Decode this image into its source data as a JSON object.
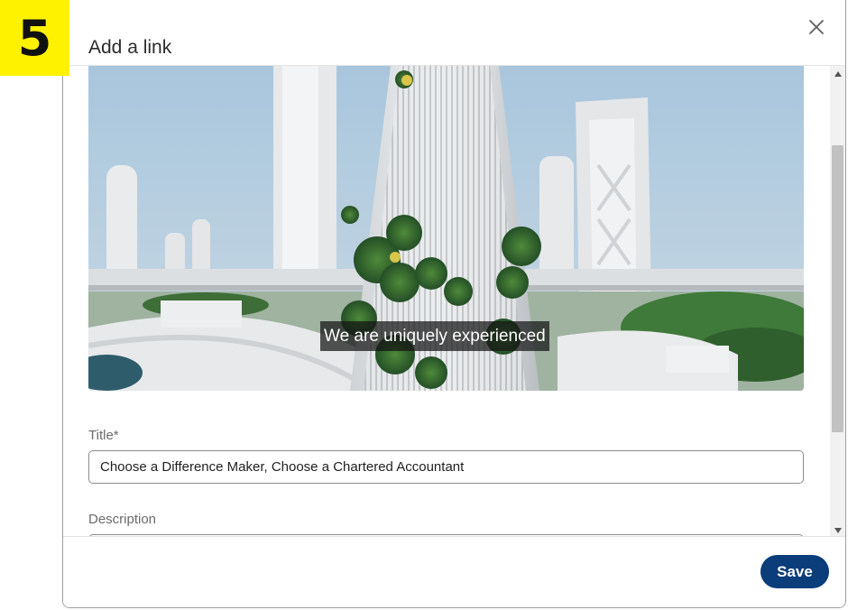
{
  "step_badge": "5",
  "dialog": {
    "title": "Add a link",
    "close_icon": "close-icon"
  },
  "preview": {
    "caption": "We are uniquely experienced"
  },
  "form": {
    "title_label": "Title",
    "title_required_marker": "*",
    "title_value": "Choose a Difference Maker, Choose a Chartered Accountant",
    "description_label": "Description",
    "description_value": ""
  },
  "footer": {
    "save_label": "Save"
  },
  "colors": {
    "badge": "#fff200",
    "save_button": "#0a3d7a",
    "sky": "#a9c6dd"
  }
}
